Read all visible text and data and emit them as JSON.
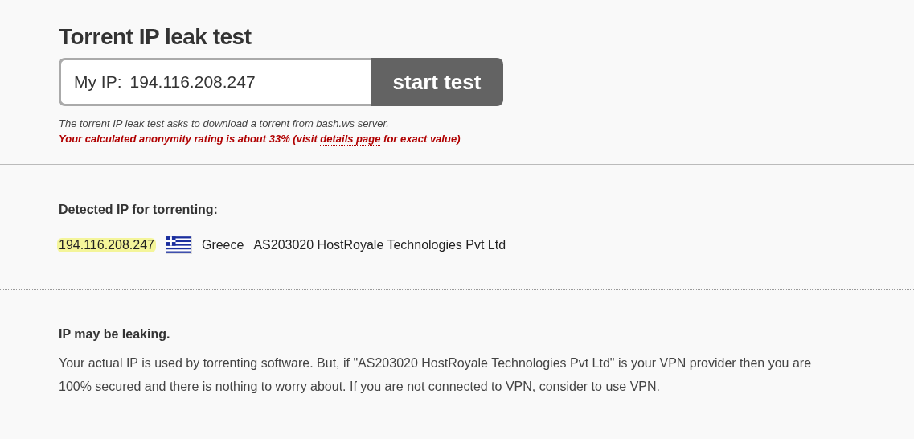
{
  "title": "Torrent IP leak test",
  "ip_field": {
    "label": "My IP:",
    "value": "194.116.208.247"
  },
  "start_button": "start test",
  "note": "The torrent IP leak test asks to download a torrent from bash.ws server.",
  "rating": {
    "before": "Your calculated anonymity rating is about 33% (visit ",
    "link": "details page",
    "after": " for exact value)"
  },
  "detected": {
    "heading": "Detected IP for torrenting:",
    "ip": "194.116.208.247",
    "country": "Greece",
    "provider": "AS203020 HostRoyale Technologies Pvt Ltd"
  },
  "verdict": {
    "heading": "IP may be leaking.",
    "text": "Your actual IP is used by torrenting software. But, if \"AS203020 HostRoyale Technologies Pvt Ltd\" is your VPN provider then you are 100% secured and there is nothing to worry about. If you are not connected to VPN, consider to use VPN."
  }
}
